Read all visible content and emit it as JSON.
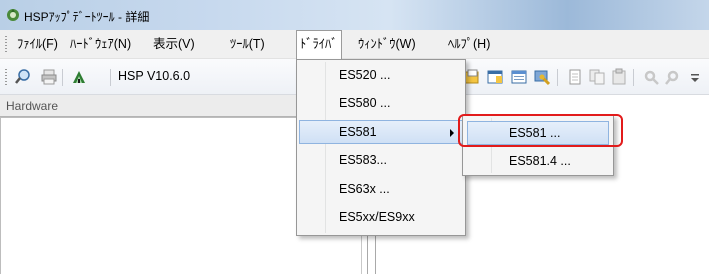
{
  "window": {
    "title": "HSPｱｯﾌﾟﾃﾞｰﾄﾂｰﾙ - 詳細",
    "icon": "app-icon"
  },
  "menubar": {
    "items": [
      {
        "label": "ﾌｧｲﾙ(F)"
      },
      {
        "label": "ﾊｰﾄﾞｳｪｱ(N)"
      },
      {
        "label": "表示(V)"
      },
      {
        "label": "ﾂｰﾙ(T)"
      },
      {
        "label": "ﾄﾞﾗｲﾊﾞ"
      },
      {
        "label": "ｳｨﾝﾄﾞｳ(W)"
      },
      {
        "label": "ﾍﾙﾌﾟ(H)"
      }
    ]
  },
  "toolbar": {
    "version": "HSP V10.6.0",
    "icons": [
      "search-icon",
      "printer-icon",
      "update-icon",
      "open-file-icon",
      "properties-icon",
      "window-icon",
      "configure-icon",
      "page-icon",
      "copy-icon",
      "paste-icon",
      "settings-icon",
      "settings-alt-icon"
    ]
  },
  "panel": {
    "header": "Hardware"
  },
  "driver_menu": {
    "items": [
      {
        "label": "ES520 ..."
      },
      {
        "label": "ES580 ..."
      },
      {
        "label": "ES581"
      },
      {
        "label": "ES583..."
      },
      {
        "label": "ES63x ..."
      },
      {
        "label": "ES5xx/ES9xx"
      }
    ],
    "selected": "ES581"
  },
  "es581_submenu": {
    "items": [
      {
        "label": "ES581 ..."
      },
      {
        "label": "ES581.4 ..."
      }
    ],
    "highlighted": "ES581 ...",
    "highlight_color": "#e21b1b"
  }
}
